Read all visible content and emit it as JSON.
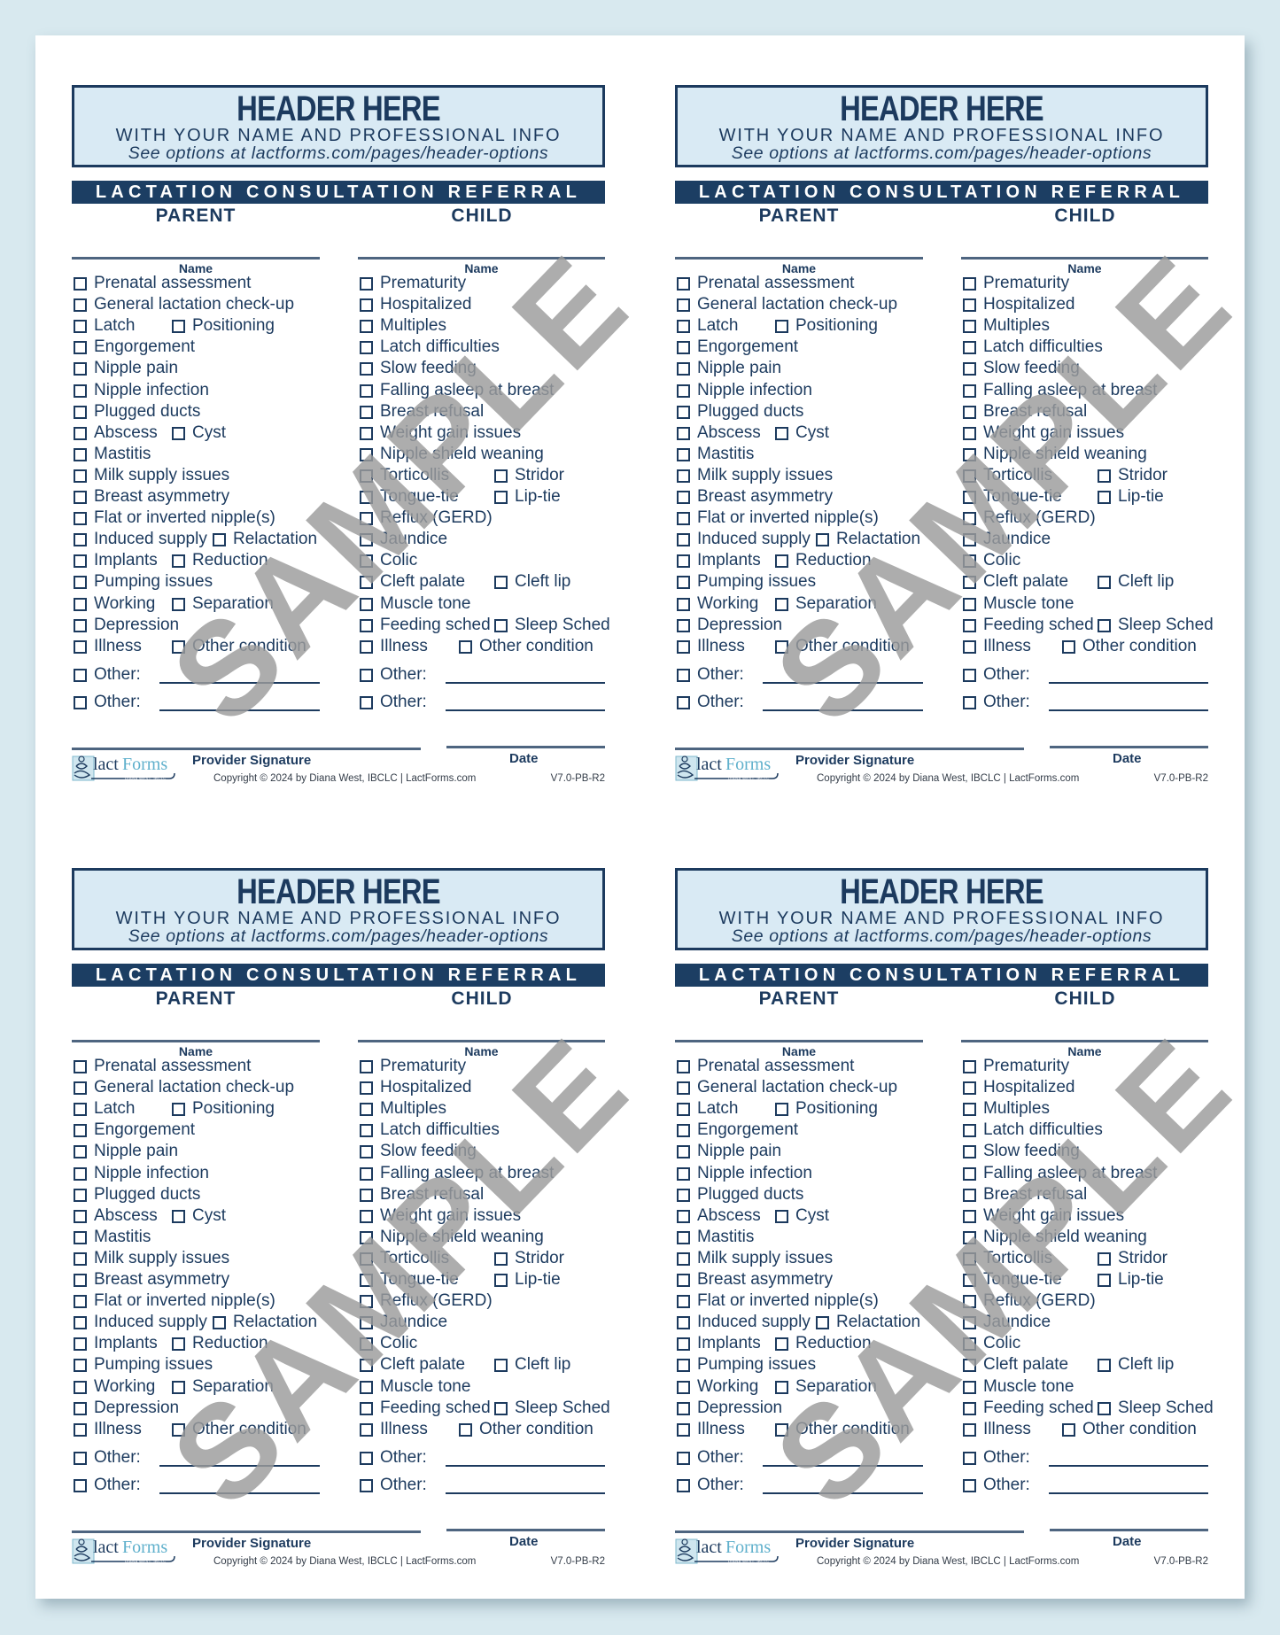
{
  "page": {
    "background_color": "#d8e9ef",
    "accent_color": "#1c3e63"
  },
  "form": {
    "header_title": "HEADER HERE",
    "header_subtitle": "WITH YOUR NAME AND PROFESSIONAL INFO",
    "header_link": "See options at lactforms.com/pages/header-options",
    "title": "LACTATION CONSULTATION REFERRAL",
    "parent_heading": "PARENT",
    "child_heading": "CHILD",
    "name_label": "Name",
    "parent_items": [
      [
        "Prenatal assessment"
      ],
      [
        "General lactation check-up"
      ],
      [
        "Latch",
        "Positioning"
      ],
      [
        "Engorgement"
      ],
      [
        "Nipple pain"
      ],
      [
        "Nipple infection"
      ],
      [
        "Plugged ducts"
      ],
      [
        "Abscess",
        "Cyst"
      ],
      [
        "Mastitis"
      ],
      [
        "Milk supply issues"
      ],
      [
        "Breast asymmetry"
      ],
      [
        "Flat or inverted nipple(s)"
      ],
      [
        "Induced supply",
        "Relactation"
      ],
      [
        "Implants",
        "Reduction"
      ],
      [
        "Pumping issues"
      ],
      [
        "Working",
        "Separation"
      ],
      [
        "Depression"
      ],
      [
        "Illness",
        "Other condition"
      ]
    ],
    "child_items": [
      [
        "Prematurity"
      ],
      [
        "Hospitalized"
      ],
      [
        "Multiples"
      ],
      [
        "Latch difficulties"
      ],
      [
        "Slow feeding"
      ],
      [
        "Falling asleep at breast"
      ],
      [
        "Breast refusal"
      ],
      [
        "Weight gain issues"
      ],
      [
        "Nipple shield weaning"
      ],
      [
        "Torticollis",
        "Stridor"
      ],
      [
        "Tongue-tie",
        "Lip-tie"
      ],
      [
        "Reflux (GERD)"
      ],
      [
        "Jaundice"
      ],
      [
        "Colic"
      ],
      [
        "Cleft palate",
        "Cleft lip"
      ],
      [
        "Muscle tone"
      ],
      [
        "Feeding sched",
        "Sleep Sched"
      ],
      [
        "Illness",
        "Other condition"
      ]
    ],
    "other_label": "Other:",
    "signature_label": "Provider Signature",
    "date_label": "Date",
    "logo_text_1": "lact",
    "logo_text_2": "Forms",
    "logo_tagline": "DIANA WEST, IBCLC",
    "copyright": "Copyright © 2024 by Diana West, IBCLC  |  LactForms.com",
    "version": "V7.0-PB-R2",
    "watermark": "SAMPLE"
  },
  "forms": [
    {
      "id": "top-left"
    },
    {
      "id": "top-right"
    },
    {
      "id": "bottom-left"
    },
    {
      "id": "bottom-right"
    }
  ]
}
